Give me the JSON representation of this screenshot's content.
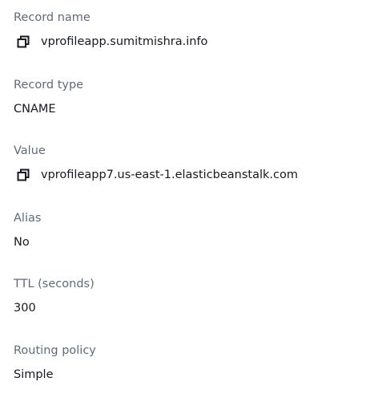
{
  "record_details": {
    "record_name": {
      "label": "Record name",
      "value": "vprofileapp.sumitmishra.info",
      "icon": "copy-icon"
    },
    "record_type": {
      "label": "Record type",
      "value": "CNAME"
    },
    "value": {
      "label": "Value",
      "value": "vprofileapp7.us-east-1.elasticbeanstalk.com",
      "icon": "copy-icon"
    },
    "alias": {
      "label": "Alias",
      "value": "No"
    },
    "ttl": {
      "label": "TTL (seconds)",
      "value": "300"
    },
    "routing_policy": {
      "label": "Routing policy",
      "value": "Simple"
    }
  },
  "colors": {
    "label": "#5f6b7a",
    "value": "#16191f"
  }
}
